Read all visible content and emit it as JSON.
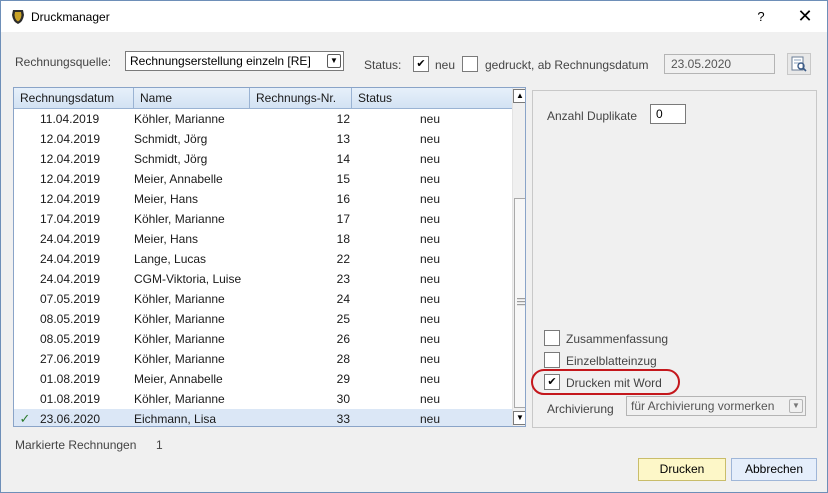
{
  "window": {
    "title": "Druckmanager",
    "help_label": "?",
    "close_label": "✕"
  },
  "source": {
    "label": "Rechnungsquelle:",
    "selected": "Rechnungserstellung einzeln [RE]"
  },
  "status_filter": {
    "label": "Status:",
    "neu_label": "neu",
    "neu_checked": true,
    "gedruckt_label": "gedruckt, ab Rechnungsdatum",
    "gedruckt_checked": false,
    "date_value": "23.05.2020"
  },
  "table": {
    "columns": [
      "Rechnungsdatum",
      "Name",
      "Rechnungs-Nr.",
      "Status"
    ],
    "rows": [
      {
        "mark": "",
        "date": "11.04.2019",
        "name": "Köhler, Marianne",
        "nr": "12",
        "status": "neu"
      },
      {
        "mark": "",
        "date": "12.04.2019",
        "name": "Schmidt, Jörg",
        "nr": "13",
        "status": "neu"
      },
      {
        "mark": "",
        "date": "12.04.2019",
        "name": "Schmidt, Jörg",
        "nr": "14",
        "status": "neu"
      },
      {
        "mark": "",
        "date": "12.04.2019",
        "name": "Meier, Annabelle",
        "nr": "15",
        "status": "neu"
      },
      {
        "mark": "",
        "date": "12.04.2019",
        "name": "Meier, Hans",
        "nr": "16",
        "status": "neu"
      },
      {
        "mark": "",
        "date": "17.04.2019",
        "name": "Köhler, Marianne",
        "nr": "17",
        "status": "neu"
      },
      {
        "mark": "",
        "date": "24.04.2019",
        "name": "Meier, Hans",
        "nr": "18",
        "status": "neu"
      },
      {
        "mark": "",
        "date": "24.04.2019",
        "name": "Lange, Lucas",
        "nr": "22",
        "status": "neu"
      },
      {
        "mark": "",
        "date": "24.04.2019",
        "name": "CGM-Viktoria, Luise",
        "nr": "23",
        "status": "neu"
      },
      {
        "mark": "",
        "date": "07.05.2019",
        "name": "Köhler, Marianne",
        "nr": "24",
        "status": "neu"
      },
      {
        "mark": "",
        "date": "08.05.2019",
        "name": "Köhler, Marianne",
        "nr": "25",
        "status": "neu"
      },
      {
        "mark": "",
        "date": "08.05.2019",
        "name": "Köhler, Marianne",
        "nr": "26",
        "status": "neu"
      },
      {
        "mark": "",
        "date": "27.06.2019",
        "name": "Köhler, Marianne",
        "nr": "28",
        "status": "neu"
      },
      {
        "mark": "",
        "date": "01.08.2019",
        "name": "Meier, Annabelle",
        "nr": "29",
        "status": "neu"
      },
      {
        "mark": "",
        "date": "01.08.2019",
        "name": "Köhler, Marianne",
        "nr": "30",
        "status": "neu"
      },
      {
        "mark": "✓",
        "date": "23.06.2020",
        "name": "Eichmann, Lisa",
        "nr": "33",
        "status": "neu",
        "selected": true
      }
    ]
  },
  "marked": {
    "label": "Markierte Rechnungen",
    "count": "1"
  },
  "options": {
    "duplicates_label": "Anzahl Duplikate",
    "duplicates_value": "0",
    "zusammenfassung_label": "Zusammenfassung",
    "zusammenfassung_checked": false,
    "einzelblatt_label": "Einzelblatteinzug",
    "einzelblatt_checked": false,
    "word_label": "Drucken mit Word",
    "word_checked": true,
    "archivierung_label": "Archivierung",
    "archivierung_value": "für Archivierung vormerken"
  },
  "buttons": {
    "print": "Drucken",
    "cancel": "Abbrechen"
  },
  "colors": {
    "highlight_ring": "#c4171c",
    "selected_row": "#dbe7f6"
  }
}
